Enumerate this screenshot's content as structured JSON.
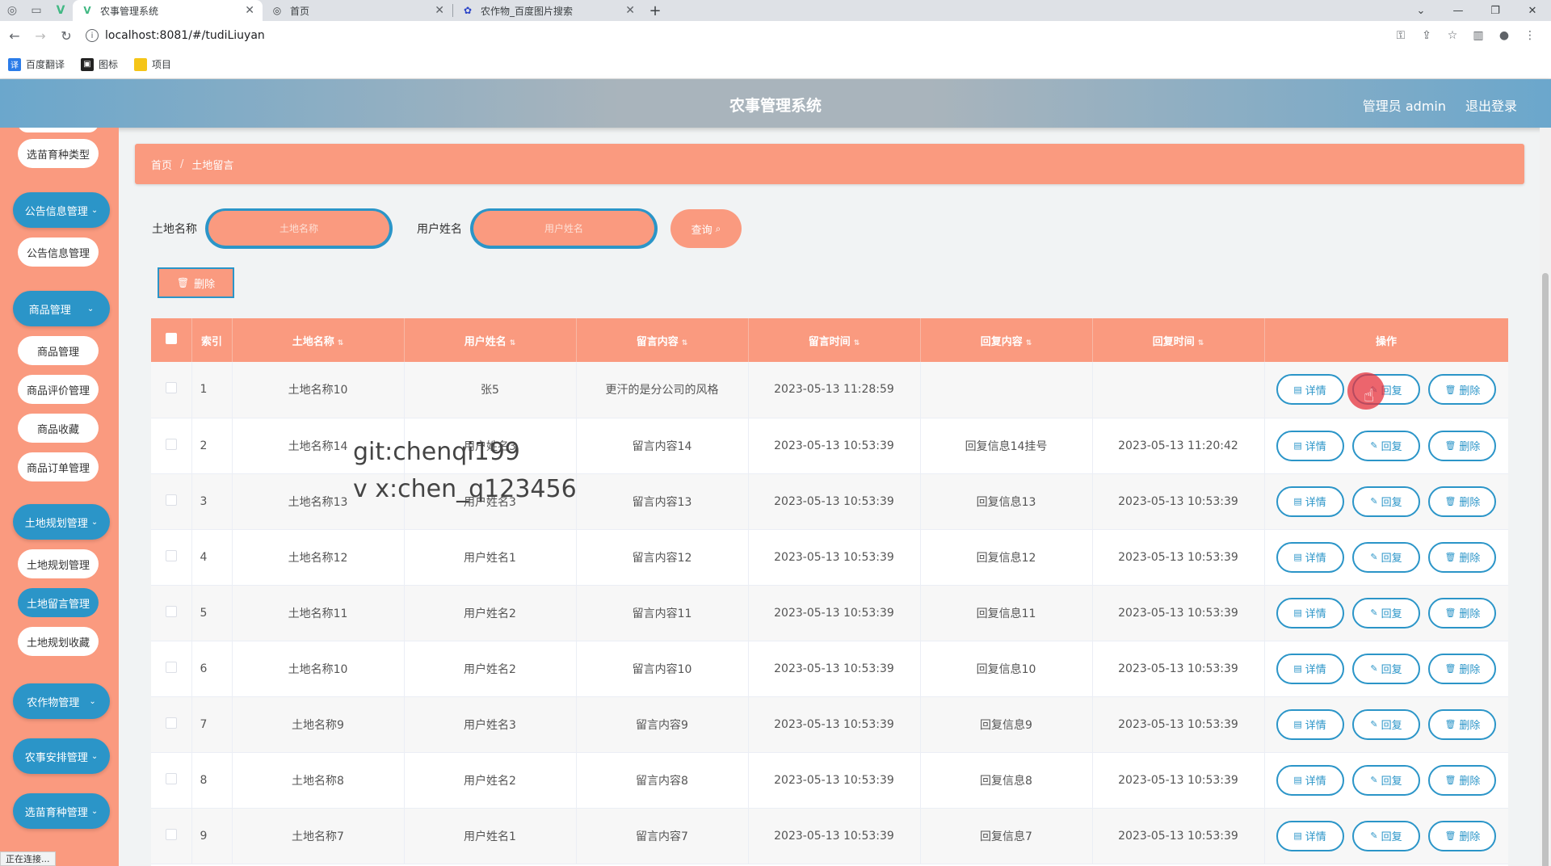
{
  "browser": {
    "tabs": [
      {
        "label": "农事管理系统",
        "active": true,
        "icon": "vue-icon"
      },
      {
        "label": "首页",
        "active": false,
        "icon": "globe-icon"
      },
      {
        "label": "农作物_百度图片搜索",
        "active": false,
        "icon": "baidu-paw-icon"
      }
    ],
    "url": "localhost:8081/#/tudiLiuyan",
    "bookmarks": [
      {
        "label": "百度翻译",
        "color": "#2b7ce9"
      },
      {
        "label": "图标",
        "color": "#222222"
      },
      {
        "label": "项目",
        "color": "#f5c518"
      }
    ]
  },
  "header": {
    "title": "农事管理系统",
    "user": "管理员 admin",
    "logout": "退出登录"
  },
  "sidebar": {
    "items": [
      {
        "type": "sub",
        "label": "选苗育种类型"
      },
      {
        "type": "group",
        "label": "公告信息管理"
      },
      {
        "type": "sub",
        "label": "公告信息管理"
      },
      {
        "type": "group",
        "label": "商品管理"
      },
      {
        "type": "sub",
        "label": "商品管理"
      },
      {
        "type": "sub",
        "label": "商品评价管理"
      },
      {
        "type": "sub",
        "label": "商品收藏"
      },
      {
        "type": "sub",
        "label": "商品订单管理"
      },
      {
        "type": "group",
        "label": "土地规划管理"
      },
      {
        "type": "sub",
        "label": "土地规划管理"
      },
      {
        "type": "sub",
        "label": "土地留言管理",
        "active": true
      },
      {
        "type": "sub",
        "label": "土地规划收藏"
      },
      {
        "type": "group",
        "label": "农作物管理"
      },
      {
        "type": "group",
        "label": "农事安排管理"
      },
      {
        "type": "group",
        "label": "选苗育种管理"
      }
    ]
  },
  "breadcrumb": {
    "home": "首页",
    "current": "土地留言"
  },
  "search": {
    "land_label": "土地名称",
    "land_placeholder": "土地名称",
    "user_label": "用户姓名",
    "user_placeholder": "用户姓名",
    "button": "查询"
  },
  "toolbar": {
    "delete_label": "删除"
  },
  "table": {
    "headers": [
      "索引",
      "土地名称",
      "用户姓名",
      "留言内容",
      "留言时间",
      "回复内容",
      "回复时间",
      "操作"
    ],
    "actions": {
      "detail": "详情",
      "reply": "回复",
      "delete": "删除"
    },
    "rows": [
      {
        "index": "1",
        "land": "土地名称10",
        "user": "张5",
        "content": "更汗的是分公司的风格",
        "time": "2023-05-13 11:28:59",
        "reply": "",
        "reply_time": ""
      },
      {
        "index": "2",
        "land": "土地名称14",
        "user": "用户姓名3",
        "content": "留言内容14",
        "time": "2023-05-13 10:53:39",
        "reply": "回复信息14挂号",
        "reply_time": "2023-05-13 11:20:42"
      },
      {
        "index": "3",
        "land": "土地名称13",
        "user": "用户姓名3",
        "content": "留言内容13",
        "time": "2023-05-13 10:53:39",
        "reply": "回复信息13",
        "reply_time": "2023-05-13 10:53:39"
      },
      {
        "index": "4",
        "land": "土地名称12",
        "user": "用户姓名1",
        "content": "留言内容12",
        "time": "2023-05-13 10:53:39",
        "reply": "回复信息12",
        "reply_time": "2023-05-13 10:53:39"
      },
      {
        "index": "5",
        "land": "土地名称11",
        "user": "用户姓名2",
        "content": "留言内容11",
        "time": "2023-05-13 10:53:39",
        "reply": "回复信息11",
        "reply_time": "2023-05-13 10:53:39"
      },
      {
        "index": "6",
        "land": "土地名称10",
        "user": "用户姓名2",
        "content": "留言内容10",
        "time": "2023-05-13 10:53:39",
        "reply": "回复信息10",
        "reply_time": "2023-05-13 10:53:39"
      },
      {
        "index": "7",
        "land": "土地名称9",
        "user": "用户姓名3",
        "content": "留言内容9",
        "time": "2023-05-13 10:53:39",
        "reply": "回复信息9",
        "reply_time": "2023-05-13 10:53:39"
      },
      {
        "index": "8",
        "land": "土地名称8",
        "user": "用户姓名2",
        "content": "留言内容8",
        "time": "2023-05-13 10:53:39",
        "reply": "回复信息8",
        "reply_time": "2023-05-13 10:53:39"
      },
      {
        "index": "9",
        "land": "土地名称7",
        "user": "用户姓名1",
        "content": "留言内容7",
        "time": "2023-05-13 10:53:39",
        "reply": "回复信息7",
        "reply_time": "2023-05-13 10:53:39"
      }
    ]
  },
  "watermark": [
    "git:chenqi199",
    "v x:chen_q123456"
  ],
  "status_text": "正在连接...",
  "colors": {
    "accent": "#fa9a7f",
    "primary": "#2b95c8"
  }
}
